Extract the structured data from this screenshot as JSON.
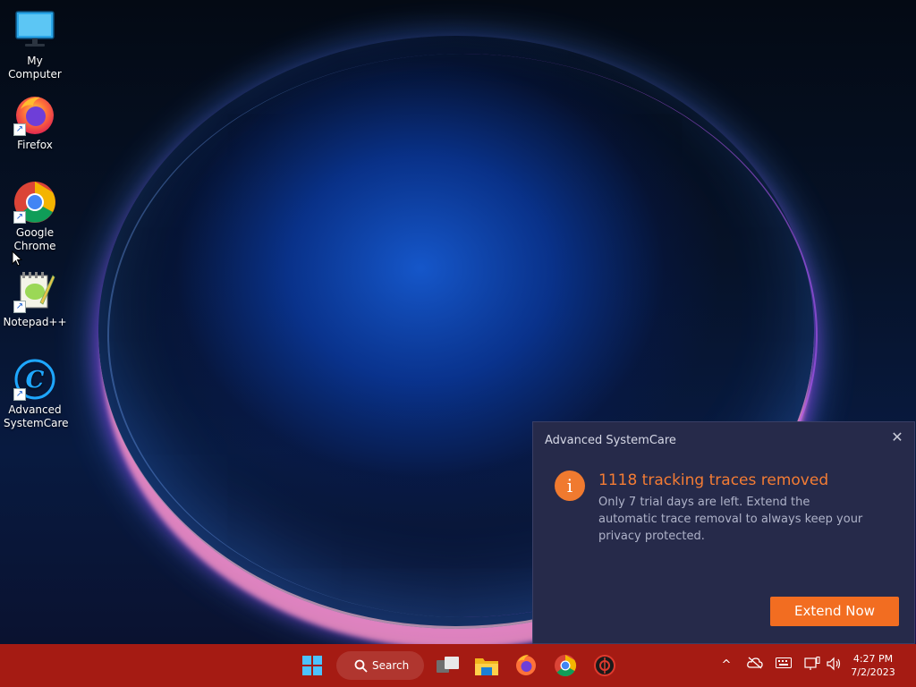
{
  "desktop": {
    "icons": [
      {
        "label": "My Computer",
        "icon": "monitor-icon"
      },
      {
        "label": "Firefox",
        "icon": "firefox-icon"
      },
      {
        "label": "Google Chrome",
        "icon": "chrome-icon"
      },
      {
        "label": "Notepad++",
        "icon": "notepad-plus-plus-icon"
      },
      {
        "label": "Advanced SystemCare",
        "icon": "advanced-systemcare-icon"
      }
    ]
  },
  "notification": {
    "app_name": "Advanced SystemCare",
    "close_glyph": "✕",
    "info_glyph": "i",
    "headline": "1118 tracking traces removed",
    "body": "Only 7 trial days are left. Extend the automatic trace removal to always keep your privacy protected.",
    "button_label": "Extend Now",
    "accent_color": "#f47c34",
    "background_color": "#262a4a"
  },
  "taskbar": {
    "background_color": "#a51b13",
    "search_label": "Search",
    "pinned": [
      "windows-start-icon",
      "task-view-icon",
      "file-explorer-icon",
      "firefox-icon",
      "chrome-icon",
      "advanced-systemcare-icon"
    ],
    "tray": {
      "overflow_glyph": "^",
      "time": "4:27 PM",
      "date": "7/2/2023"
    }
  }
}
